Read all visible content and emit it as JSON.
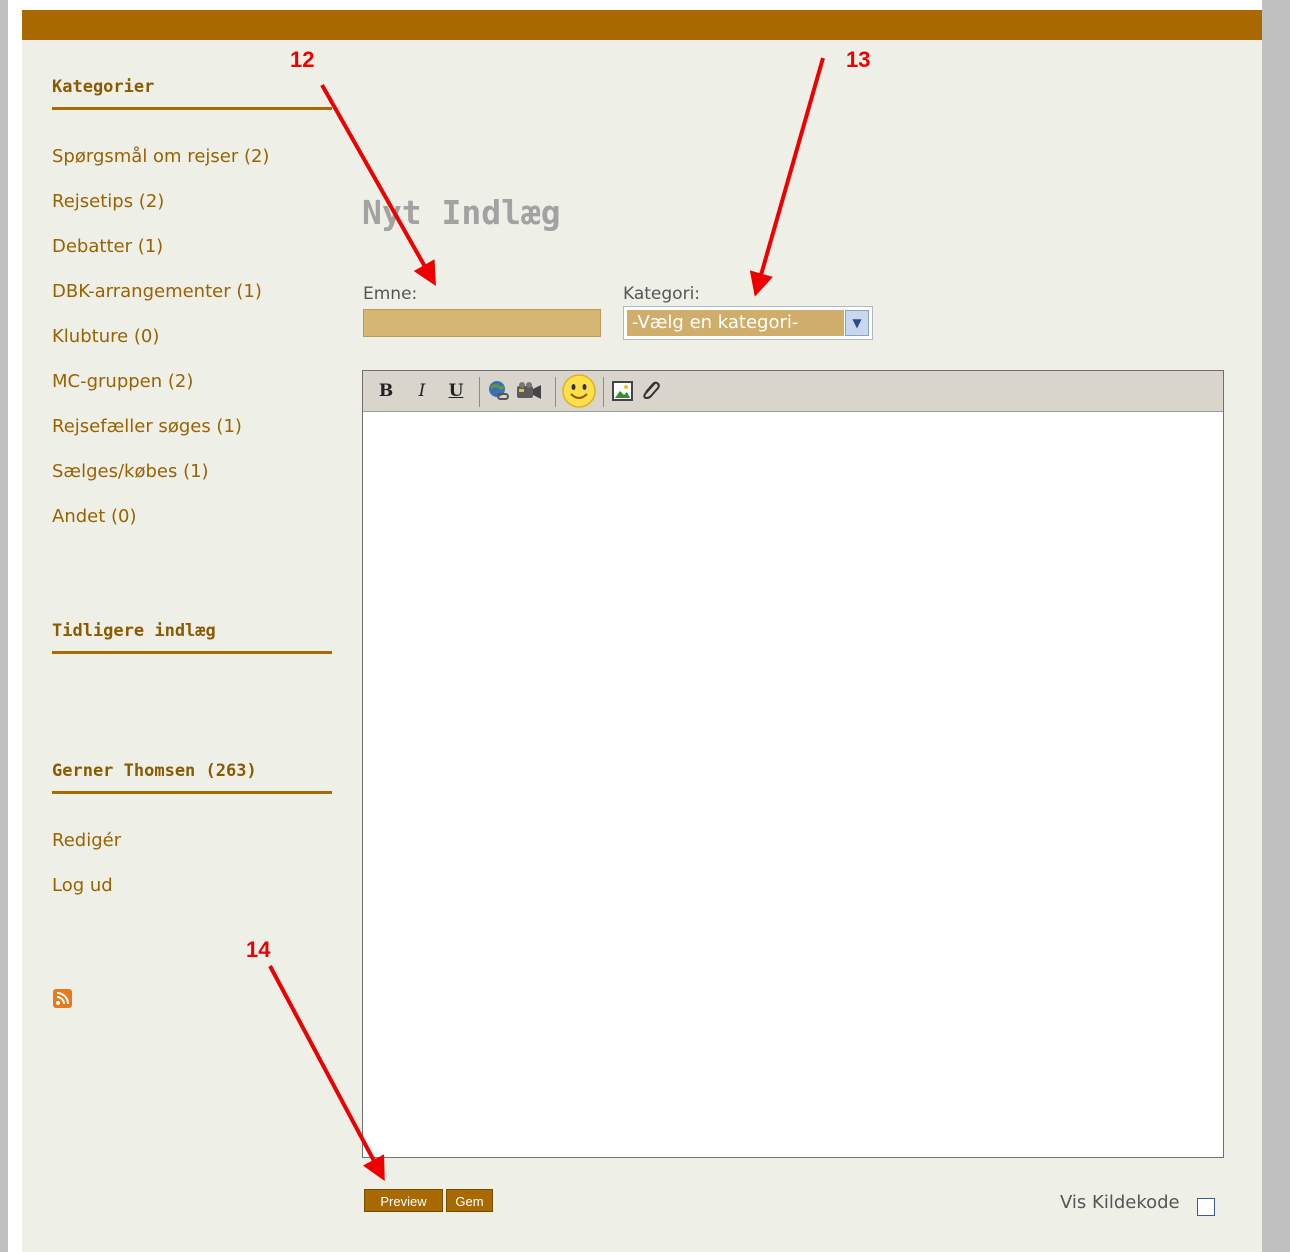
{
  "sidebar": {
    "categories_heading": "Kategorier",
    "categories": [
      "Spørgsmål om rejser (2)",
      "Rejsetips (2)",
      "Debatter (1)",
      "DBK-arrangementer (1)",
      "Klubture (0)",
      "MC-gruppen (2)",
      "Rejsefæller søges (1)",
      "Sælges/købes (1)",
      "Andet (0)"
    ],
    "earlier_heading": "Tidligere indlæg",
    "user_heading": "Gerner Thomsen (263)",
    "user_links": [
      "Redigér",
      "Log ud"
    ],
    "rss_icon": "rss-icon"
  },
  "main": {
    "title": "Nyt Indlæg",
    "emne_label": "Emne:",
    "emne_value": "",
    "kategori_label": "Kategori:",
    "kategori_selected": "-Vælg en kategori-",
    "toolbar": {
      "bold": "B",
      "italic": "I",
      "underline": "U",
      "icons": [
        "link-icon",
        "video-icon",
        "smiley-icon",
        "image-icon",
        "attachment-icon"
      ]
    },
    "preview_label": "Preview",
    "save_label": "Gem",
    "source_label": "Vis Kildekode"
  },
  "annotations": [
    "12",
    "13",
    "14"
  ],
  "colors": {
    "accent": "#a86a00",
    "input_bg": "#d6b673",
    "page_bg": "#eef0e8",
    "annotation": "#ee0000"
  }
}
